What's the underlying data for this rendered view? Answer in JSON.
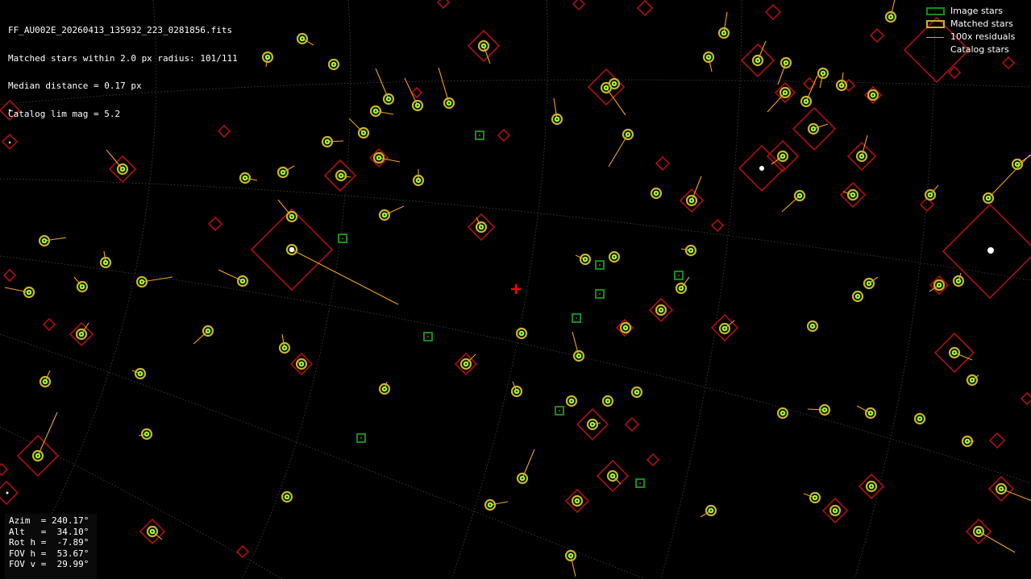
{
  "info": {
    "filename": "FF_AU002E_20260413_135932_223_0281856.fits",
    "matched": "Matched stars within 2.0 px radius: 101/111",
    "median": "Median distance = 0.17 px",
    "catalog": "Catalog lim mag = 5.2"
  },
  "legend": {
    "image_stars": "Image stars",
    "matched_stars": "Matched stars",
    "residuals": "100x residuals",
    "catalog_stars": "Catalog stars"
  },
  "coords": {
    "azim": "Azim  = 240.17°",
    "alt": "Alt   =  34.10°",
    "rot": "Rot h =  -7.89°",
    "fov_h": "FOV h =  53.67°",
    "fov_v": "FOV v =  29.99°"
  },
  "colors": {
    "background": "#000000",
    "image_star": "#1a8a1a",
    "matched_star": "#c8b628",
    "matched_fill": "#99ff33",
    "residual": "#f0a020",
    "catalog_star": "#aa1010",
    "center_marker": "#ff0000",
    "grid": "#555555"
  },
  "icons": {
    "center_marker": "red-plus-icon"
  }
}
